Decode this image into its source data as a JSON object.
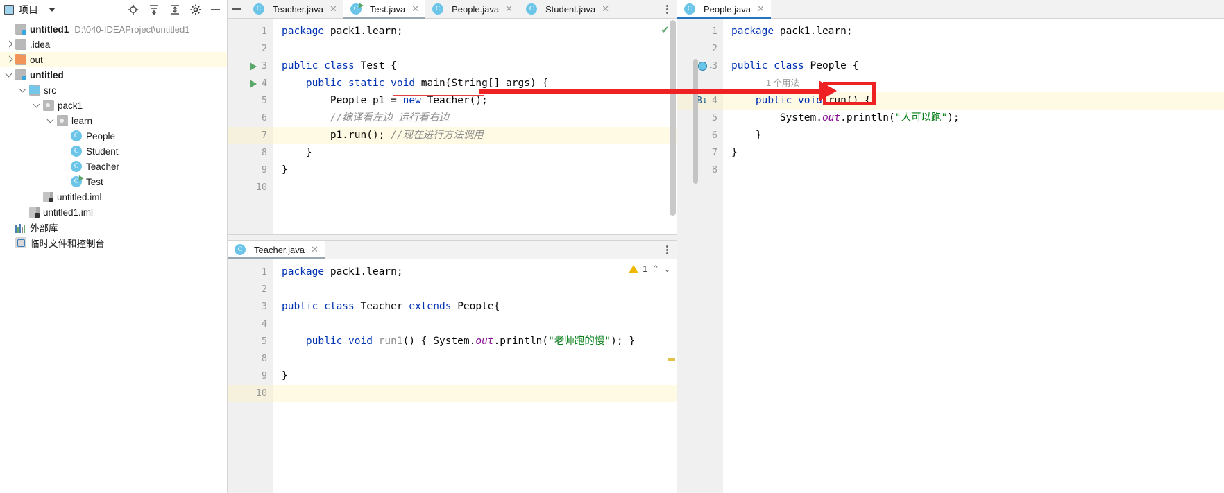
{
  "sidebar": {
    "header": {
      "title": "项目",
      "icons": [
        "project-icon",
        "caret-down-icon",
        "locate-icon",
        "expand-all-icon",
        "collapse-all-icon",
        "settings-icon",
        "hide-icon"
      ]
    },
    "tree": [
      {
        "label": "untitled1",
        "detail": "D:\\040-IDEAProject\\untitled1",
        "indent": 0,
        "arrow": "none",
        "icon": "module-folder",
        "bold": true,
        "highlight": false
      },
      {
        "label": ".idea",
        "detail": "",
        "indent": 0,
        "arrow": "right",
        "icon": "folder-gray",
        "bold": false,
        "highlight": false
      },
      {
        "label": "out",
        "detail": "",
        "indent": 0,
        "arrow": "right",
        "icon": "folder-orange",
        "bold": false,
        "highlight": true
      },
      {
        "label": "untitled",
        "detail": "",
        "indent": 0,
        "arrow": "down",
        "icon": "module-folder",
        "bold": true,
        "highlight": false
      },
      {
        "label": "src",
        "detail": "",
        "indent": 1,
        "arrow": "down",
        "icon": "folder-blue",
        "bold": false,
        "highlight": false
      },
      {
        "label": "pack1",
        "detail": "",
        "indent": 2,
        "arrow": "down",
        "icon": "package-folder",
        "bold": false,
        "highlight": false
      },
      {
        "label": "learn",
        "detail": "",
        "indent": 3,
        "arrow": "down",
        "icon": "package-folder",
        "bold": false,
        "highlight": false
      },
      {
        "label": "People",
        "detail": "",
        "indent": 4,
        "arrow": "none",
        "icon": "java-class",
        "bold": false,
        "highlight": false
      },
      {
        "label": "Student",
        "detail": "",
        "indent": 4,
        "arrow": "none",
        "icon": "java-class",
        "bold": false,
        "highlight": false
      },
      {
        "label": "Teacher",
        "detail": "",
        "indent": 4,
        "arrow": "none",
        "icon": "java-class",
        "bold": false,
        "highlight": false
      },
      {
        "label": "Test",
        "detail": "",
        "indent": 4,
        "arrow": "none",
        "icon": "java-class-runnable",
        "bold": false,
        "highlight": false
      },
      {
        "label": "untitled.iml",
        "detail": "",
        "indent": 2,
        "arrow": "none",
        "icon": "iml-file",
        "bold": false,
        "highlight": false
      },
      {
        "label": "untitled1.iml",
        "detail": "",
        "indent": 1,
        "arrow": "none",
        "icon": "iml-file",
        "bold": false,
        "highlight": false
      },
      {
        "label": "外部库",
        "detail": "",
        "indent": 0,
        "arrow": "none",
        "icon": "external-libraries",
        "bold": false,
        "highlight": false
      },
      {
        "label": "临时文件和控制台",
        "detail": "",
        "indent": 0,
        "arrow": "none",
        "icon": "scratches-consoles",
        "bold": false,
        "highlight": false
      }
    ]
  },
  "left_editor": {
    "tabs": [
      {
        "label": "Teacher.java",
        "icon": "java-class-icon",
        "active": false,
        "runnable": false
      },
      {
        "label": "Test.java",
        "icon": "java-class-runnable-icon",
        "active": true,
        "runnable": true
      },
      {
        "label": "People.java",
        "icon": "java-class-icon",
        "active": false,
        "runnable": false
      },
      {
        "label": "Student.java",
        "icon": "java-class-icon",
        "active": false,
        "runnable": false
      }
    ],
    "close_glyph": "✕",
    "inspection_status": "✔",
    "line_numbers": [
      "1",
      "2",
      "3",
      "4",
      "5",
      "6",
      "7",
      "8",
      "9",
      "10"
    ],
    "code_lines": [
      {
        "n": 1,
        "segments": [
          {
            "t": "package ",
            "c": "kw"
          },
          {
            "t": "pack1.learn;",
            "c": "pl"
          }
        ]
      },
      {
        "n": 2,
        "segments": []
      },
      {
        "n": 3,
        "segments": [
          {
            "t": "public class ",
            "c": "kw"
          },
          {
            "t": "Test {",
            "c": "pl"
          }
        ]
      },
      {
        "n": 4,
        "segments": [
          {
            "t": "    public static void ",
            "c": "kw"
          },
          {
            "t": "main",
            "c": "meth"
          },
          {
            "t": "(",
            "c": "pl"
          },
          {
            "t": "String",
            "c": "pl"
          },
          {
            "t": "[] args) {",
            "c": "pl"
          }
        ]
      },
      {
        "n": 5,
        "segments": [
          {
            "t": "        People p1 = ",
            "c": "pl"
          },
          {
            "t": "new ",
            "c": "kw"
          },
          {
            "t": "Teacher();",
            "c": "pl"
          }
        ]
      },
      {
        "n": 6,
        "segments": [
          {
            "t": "        //编译看左边 运行看右边",
            "c": "cmt"
          }
        ]
      },
      {
        "n": 7,
        "segments": [
          {
            "t": "        p1.run(); ",
            "c": "pl"
          },
          {
            "t": "//现在进行方法调用",
            "c": "cmt"
          }
        ]
      },
      {
        "n": 8,
        "segments": [
          {
            "t": "    }",
            "c": "pl"
          }
        ]
      },
      {
        "n": 9,
        "segments": [
          {
            "t": "}",
            "c": "pl"
          }
        ]
      },
      {
        "n": 10,
        "segments": []
      }
    ],
    "run_markers_on_lines": [
      3,
      4
    ],
    "highlighted_line": 7
  },
  "bottom_editor": {
    "tab": {
      "label": "Teacher.java",
      "icon": "java-class-icon"
    },
    "close_glyph": "✕",
    "warning_count": "1",
    "warning_icon": "warning-triangle-icon",
    "nav_up": "⌃",
    "nav_down": "⌄",
    "line_numbers": [
      "1",
      "2",
      "3",
      "4",
      "5",
      "8",
      "9",
      "10"
    ],
    "code_lines": [
      {
        "n": "1",
        "segments": [
          {
            "t": "package ",
            "c": "kw"
          },
          {
            "t": "pack1.learn;",
            "c": "pl"
          }
        ]
      },
      {
        "n": "2",
        "segments": []
      },
      {
        "n": "3",
        "segments": [
          {
            "t": "public class ",
            "c": "kw"
          },
          {
            "t": "Teacher ",
            "c": "pl"
          },
          {
            "t": "extends ",
            "c": "kw"
          },
          {
            "t": "People{",
            "c": "pl"
          }
        ]
      },
      {
        "n": "4",
        "segments": []
      },
      {
        "n": "5",
        "segments": [
          {
            "t": "    public void ",
            "c": "kw"
          },
          {
            "t": "run1",
            "c": "gray"
          },
          {
            "t": "() { ",
            "c": "pl"
          },
          {
            "t": "System.",
            "c": "pl"
          },
          {
            "t": "out",
            "c": "fld"
          },
          {
            "t": ".println(",
            "c": "pl"
          },
          {
            "t": "\"老师跑的慢\"",
            "c": "str"
          },
          {
            "t": "); }",
            "c": "pl"
          }
        ]
      },
      {
        "n": "8",
        "segments": []
      },
      {
        "n": "9",
        "segments": [
          {
            "t": "}",
            "c": "pl"
          }
        ]
      },
      {
        "n": "10",
        "segments": []
      }
    ],
    "highlighted_line_number": "10"
  },
  "right_editor": {
    "tab": {
      "label": "People.java",
      "icon": "java-class-icon",
      "active": true
    },
    "close_glyph": "✕",
    "line_numbers": [
      "1",
      "2",
      "3",
      "4",
      "5",
      "6",
      "7",
      "8"
    ],
    "usage_hint": "1 个用法",
    "code_lines": [
      {
        "n": "1",
        "segments": [
          {
            "t": "package ",
            "c": "kw"
          },
          {
            "t": "pack1.learn;",
            "c": "pl"
          }
        ]
      },
      {
        "n": "2",
        "segments": []
      },
      {
        "n": "3",
        "segments": [
          {
            "t": "public class ",
            "c": "kw"
          },
          {
            "t": "People {",
            "c": "pl"
          }
        ]
      },
      {
        "n": "4",
        "segments": [
          {
            "t": "    public void ",
            "c": "kw"
          },
          {
            "t": "run",
            "c": "pl"
          },
          {
            "t": "() {",
            "c": "pl"
          }
        ]
      },
      {
        "n": "5",
        "segments": [
          {
            "t": "        System.",
            "c": "pl"
          },
          {
            "t": "out",
            "c": "fld"
          },
          {
            "t": ".println(",
            "c": "pl"
          },
          {
            "t": "\"人可以跑\"",
            "c": "str"
          },
          {
            "t": ");",
            "c": "pl"
          }
        ]
      },
      {
        "n": "6",
        "segments": [
          {
            "t": "    }",
            "c": "pl"
          }
        ]
      },
      {
        "n": "7",
        "segments": [
          {
            "t": "}",
            "c": "pl"
          }
        ]
      },
      {
        "n": "8",
        "segments": []
      }
    ],
    "selected_text": "run()",
    "gutter_icons": [
      "overridden-method-icon",
      "implemented-by-icon"
    ]
  },
  "annotation": {
    "arrow_color": "#ee2222",
    "highlight_rect_color": "#ee2222",
    "strikethrough_line_color": "#e44040",
    "description": "red arrow pointing from Test.java line 5 to run() in People.java"
  },
  "colors": {
    "accent_blue": "#2675bf",
    "keyword": "#0033b3",
    "string": "#067d17",
    "comment": "#8c8c8c",
    "field": "#871094",
    "run_green": "#59a869",
    "warning_yellow": "#eeb800",
    "tab_bg": "#f2f2f2",
    "gutter_bg": "#f0f0f0",
    "highlight_row": "#fffae3"
  }
}
